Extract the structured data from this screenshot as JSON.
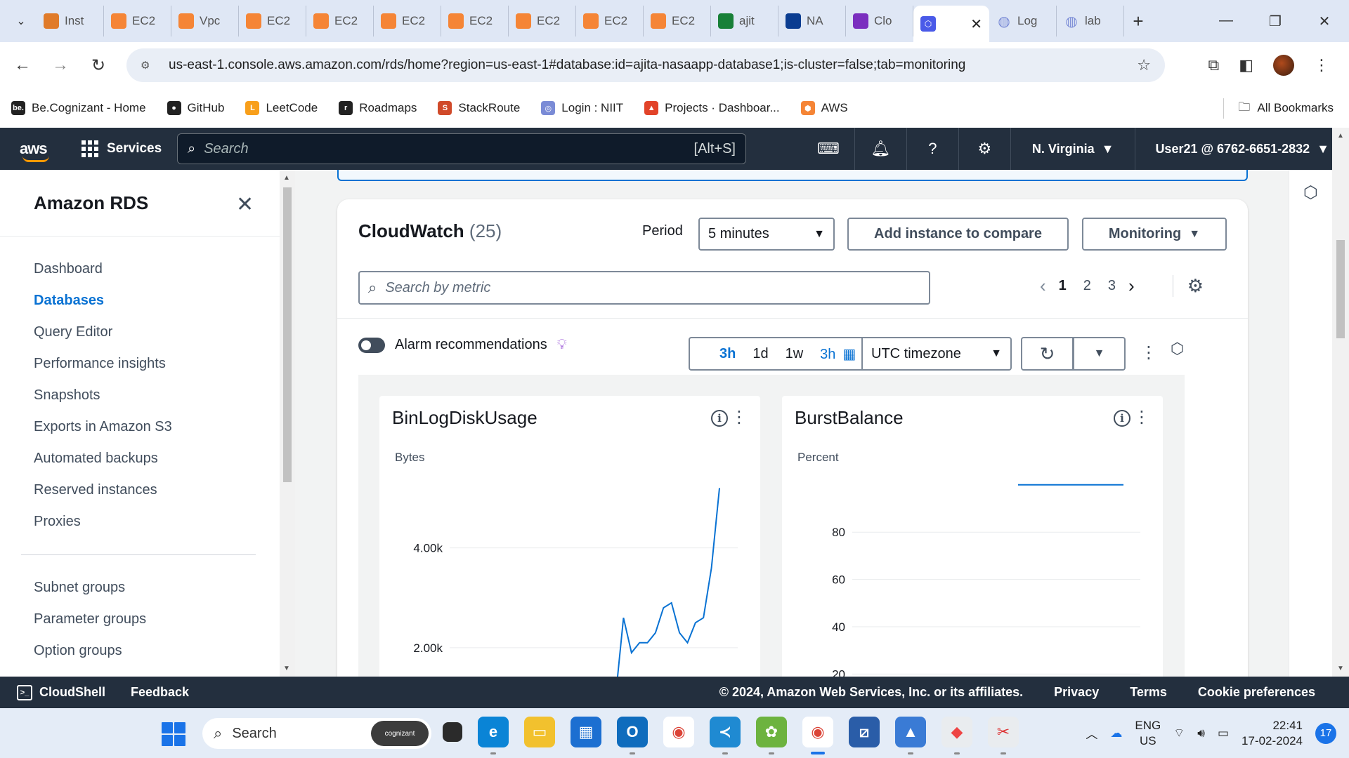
{
  "browser": {
    "tabs": [
      {
        "label": "Inst",
        "color": "#e07b2a"
      },
      {
        "label": "EC2",
        "color": "#f58536"
      },
      {
        "label": "Vpc",
        "color": "#f58536"
      },
      {
        "label": "EC2",
        "color": "#f58536"
      },
      {
        "label": "EC2",
        "color": "#f58536"
      },
      {
        "label": "EC2",
        "color": "#f58536"
      },
      {
        "label": "EC2",
        "color": "#f58536"
      },
      {
        "label": "EC2",
        "color": "#f58536"
      },
      {
        "label": "EC2",
        "color": "#f58536"
      },
      {
        "label": "EC2",
        "color": "#f58536"
      },
      {
        "label": "ajit",
        "color": "#188038"
      },
      {
        "label": "NA",
        "color": "#0b3d91"
      },
      {
        "label": "Clo",
        "color": "#7b2fbf"
      }
    ],
    "active_tab_icon_color": "#4a5ae8",
    "tail_tabs": [
      {
        "label": "Log"
      },
      {
        "label": "lab"
      }
    ],
    "url": "us-east-1.console.aws.amazon.com/rds/home?region=us-east-1#database:id=ajita-nasaapp-database1;is-cluster=false;tab=monitoring",
    "bookmarks": [
      {
        "label": "Be.Cognizant - Home",
        "icon_text": "be.",
        "color": "#222"
      },
      {
        "label": "GitHub",
        "icon_text": "●",
        "color": "#222"
      },
      {
        "label": "LeetCode",
        "icon_text": "L",
        "color": "#f89f1b"
      },
      {
        "label": "Roadmaps",
        "icon_text": "r",
        "color": "#222"
      },
      {
        "label": "StackRoute",
        "icon_text": "S",
        "color": "#d04a2a"
      },
      {
        "label": "Login : NIIT",
        "icon_text": "◎",
        "color": "#7a8bd6"
      },
      {
        "label": "Projects · Dashboar...",
        "icon_text": "▲",
        "color": "#e24329"
      },
      {
        "label": "AWS",
        "icon_text": "⬢",
        "color": "#f58536"
      }
    ],
    "all_bookmarks": "All Bookmarks"
  },
  "aws_nav": {
    "logo": "aws",
    "services": "Services",
    "search_placeholder": "Search",
    "search_shortcut": "[Alt+S]",
    "region": "N. Virginia",
    "user": "User21 @ 6762-6651-2832"
  },
  "sidebar": {
    "title": "Amazon RDS",
    "items_primary": [
      {
        "label": "Dashboard",
        "active": false
      },
      {
        "label": "Databases",
        "active": true
      },
      {
        "label": "Query Editor",
        "active": false
      },
      {
        "label": "Performance insights",
        "active": false
      },
      {
        "label": "Snapshots",
        "active": false
      },
      {
        "label": "Exports in Amazon S3",
        "active": false
      },
      {
        "label": "Automated backups",
        "active": false
      },
      {
        "label": "Reserved instances",
        "active": false
      },
      {
        "label": "Proxies",
        "active": false
      }
    ],
    "items_secondary": [
      {
        "label": "Subnet groups"
      },
      {
        "label": "Parameter groups"
      },
      {
        "label": "Option groups"
      }
    ]
  },
  "cloudwatch": {
    "title": "CloudWatch",
    "count": "(25)",
    "period_label": "Period",
    "period_value": "5 minutes",
    "add_instance_button": "Add instance to compare",
    "monitoring_button": "Monitoring",
    "search_placeholder": "Search by metric",
    "pages": [
      "1",
      "2",
      "3"
    ],
    "current_page": "1",
    "alarm_label": "Alarm recommendations",
    "time_ranges": [
      "3h",
      "1d",
      "1w"
    ],
    "custom_range": "3h",
    "timezone": "UTC timezone"
  },
  "chart_data": [
    {
      "type": "line",
      "title": "BinLogDiskUsage",
      "ylabel": "Bytes",
      "y_ticks": [
        "2.00k",
        "4.00k"
      ],
      "ylim": [
        1000,
        5500
      ],
      "values": [
        1000,
        2600,
        1900,
        2100,
        2100,
        2300,
        2800,
        2900,
        2300,
        2100,
        2500,
        2600,
        3600,
        5200
      ],
      "color": "#0972d3"
    },
    {
      "type": "line",
      "title": "BurstBalance",
      "ylabel": "Percent",
      "y_ticks": [
        "20",
        "40",
        "60",
        "80"
      ],
      "ylim": [
        10,
        105
      ],
      "values": [
        100,
        100,
        100,
        100,
        100,
        100
      ],
      "color": "#0972d3"
    }
  ],
  "footer": {
    "cloudshell": "CloudShell",
    "feedback": "Feedback",
    "copyright": "© 2024, Amazon Web Services, Inc. or its affiliates.",
    "privacy": "Privacy",
    "terms": "Terms",
    "cookies": "Cookie preferences"
  },
  "taskbar": {
    "search_placeholder": "Search",
    "search_pill": "cognizant",
    "lang_top": "ENG",
    "lang_bottom": "US",
    "time": "22:41",
    "date": "17-02-2024",
    "notifications": "17"
  }
}
